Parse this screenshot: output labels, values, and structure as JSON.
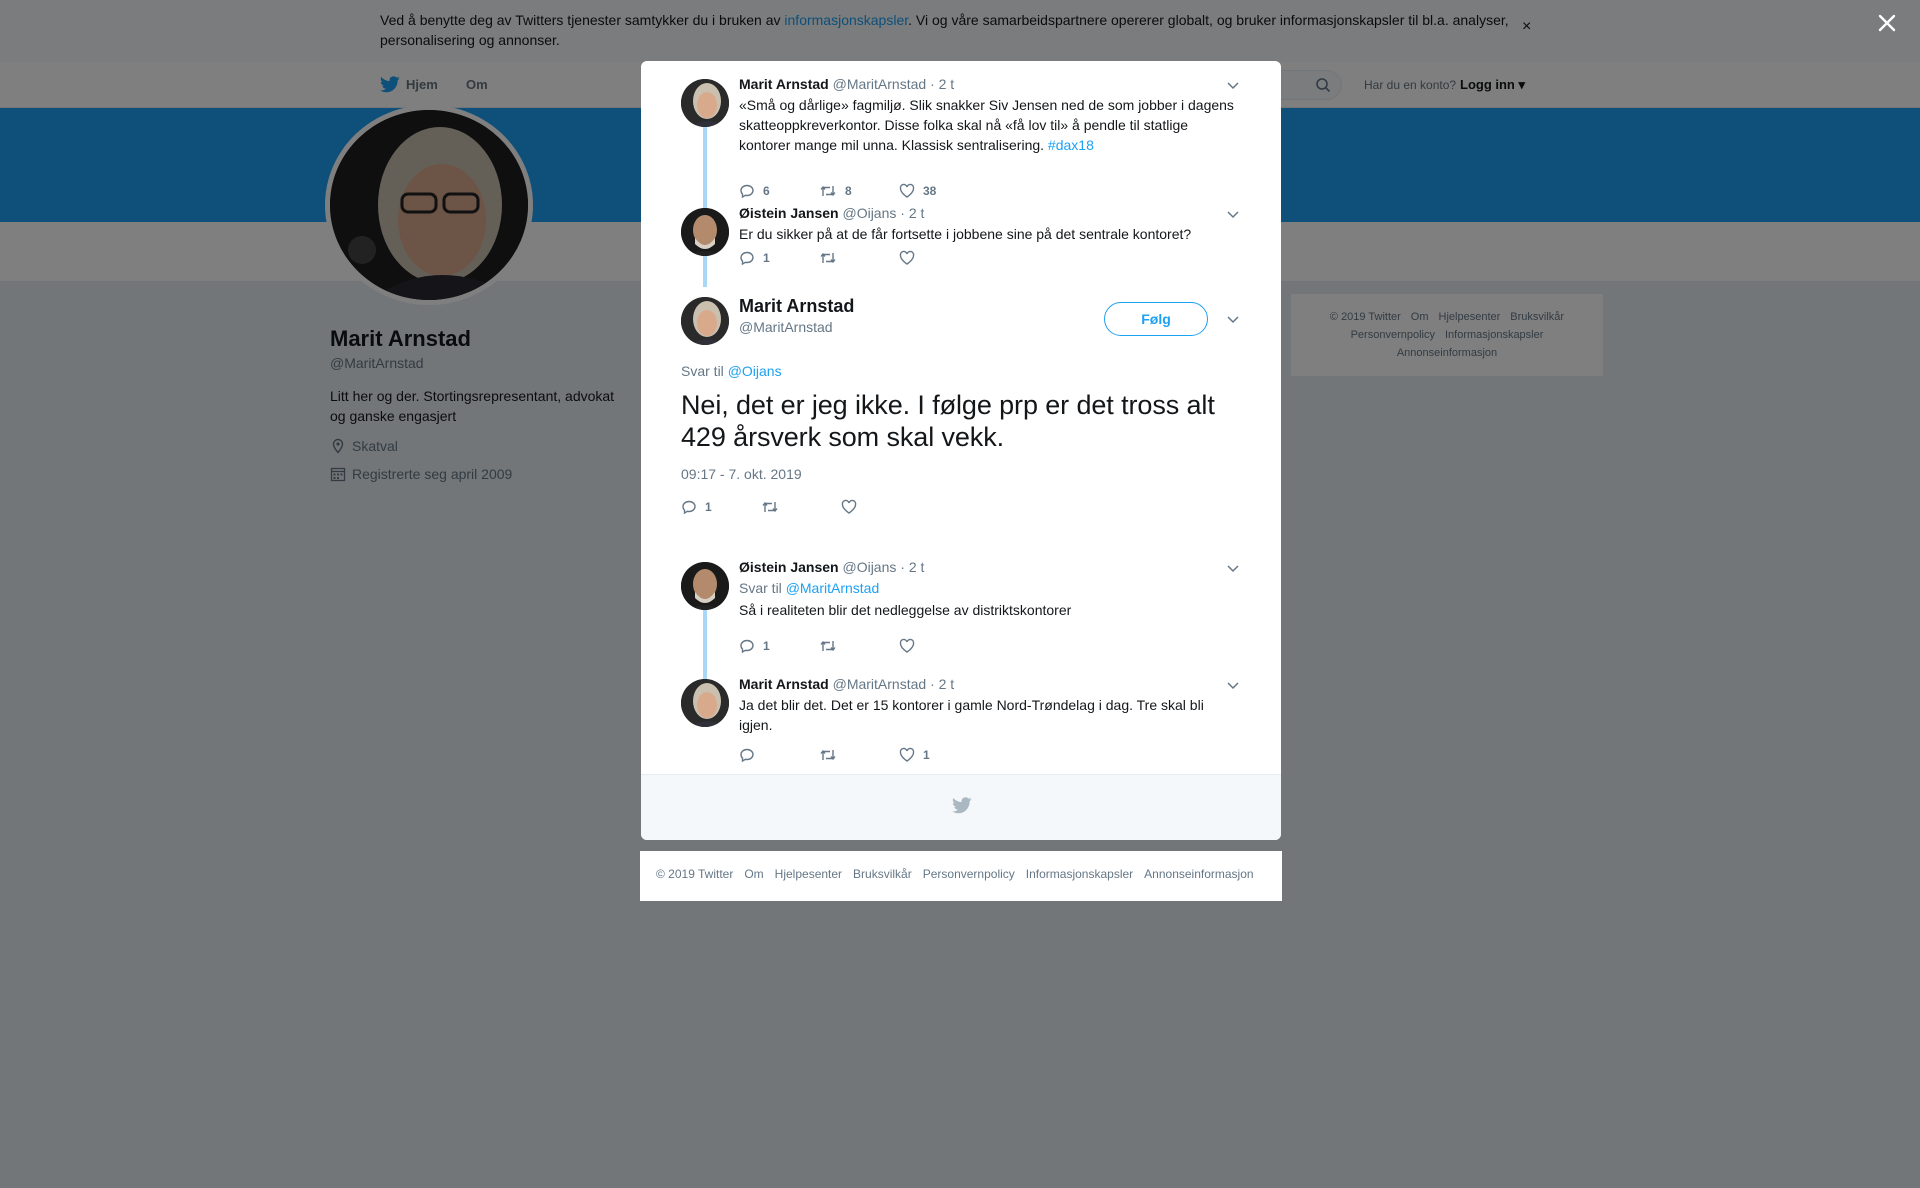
{
  "cookie": {
    "text_before": "Ved å benytte deg av Twitters tjenester samtykker du i bruken av ",
    "link": "informasjonskapsler",
    "text_after": ". Vi og våre samarbeidspartnere opererer globalt, og bruker informasjonskapsler til bl.a. analyser, personalisering og annonser.",
    "close": "×"
  },
  "nav": {
    "home": "Hjem",
    "about": "Om",
    "login_question": "Har du en konto?",
    "login": "Logg inn"
  },
  "profile": {
    "name": "Marit Arnstad",
    "handle": "@MaritArnstad",
    "bio": "Litt her og der. Stortingsrepresentant, advokat og ganske engasjert",
    "location": "Skatval",
    "joined": "Registrerte seg april 2009"
  },
  "side_footer": {
    "links": [
      "© 2019 Twitter",
      "Om",
      "Hjelpesenter",
      "Bruksvilkår",
      "Personvernpolicy",
      "Informasjonskapsler",
      "Annonseinformasjon"
    ]
  },
  "tweets": [
    {
      "name": "Marit Arnstad",
      "handle": "@MaritArnstad",
      "time": "· 2 t",
      "text": "«Små og dårlige» fagmiljø. Slik snakker Siv Jensen ned de som jobber i dagens skatteoppkreverkontor. Disse folka skal nå «få lov til» å pendle til statlige kontorer mange mil unna. Klassisk sentralisering. ",
      "hashtag": "#dax18",
      "replies": "6",
      "retweets": "8",
      "likes": "38"
    },
    {
      "name": "Øistein Jansen",
      "handle": "@Oijans",
      "time": "· 2 t",
      "text": "Er du sikker på at de får fortsette i jobbene sine på det sentrale kontoret?",
      "replies": "1",
      "retweets": "",
      "likes": ""
    }
  ],
  "main_tweet": {
    "name": "Marit Arnstad",
    "handle": "@MaritArnstad",
    "follow": "Følg",
    "reply_to_label": "Svar til",
    "reply_to": "@Oijans",
    "text": "Nei, det er jeg ikke. I følge prp er det tross alt 429 årsverk som skal vekk.",
    "timestamp": "09:17 - 7. okt. 2019",
    "replies": "1",
    "retweets": "",
    "likes": ""
  },
  "replies": [
    {
      "name": "Øistein Jansen",
      "handle": "@Oijans",
      "time": "· 2 t",
      "reply_to_label": "Svar til",
      "reply_to": "@MaritArnstad",
      "text": "Så i realiteten blir det nedleggelse av distriktskontorer",
      "replies": "1",
      "retweets": "",
      "likes": ""
    },
    {
      "name": "Marit Arnstad",
      "handle": "@MaritArnstad",
      "time": "· 2 t",
      "text": "Ja det blir det. Det er 15 kontorer i gamle Nord-Trøndelag i dag. Tre skal bli igjen.",
      "replies": "",
      "retweets": "",
      "likes": "1"
    }
  ],
  "footer": {
    "links": [
      "© 2019 Twitter",
      "Om",
      "Hjelpesenter",
      "Bruksvilkår",
      "Personvernpolicy",
      "Informasjonskapsler",
      "Annonseinformasjon"
    ]
  },
  "colors": {
    "brand": "#1da1f2",
    "overlay": "#000000",
    "thread_line": "#a8d7f7"
  }
}
